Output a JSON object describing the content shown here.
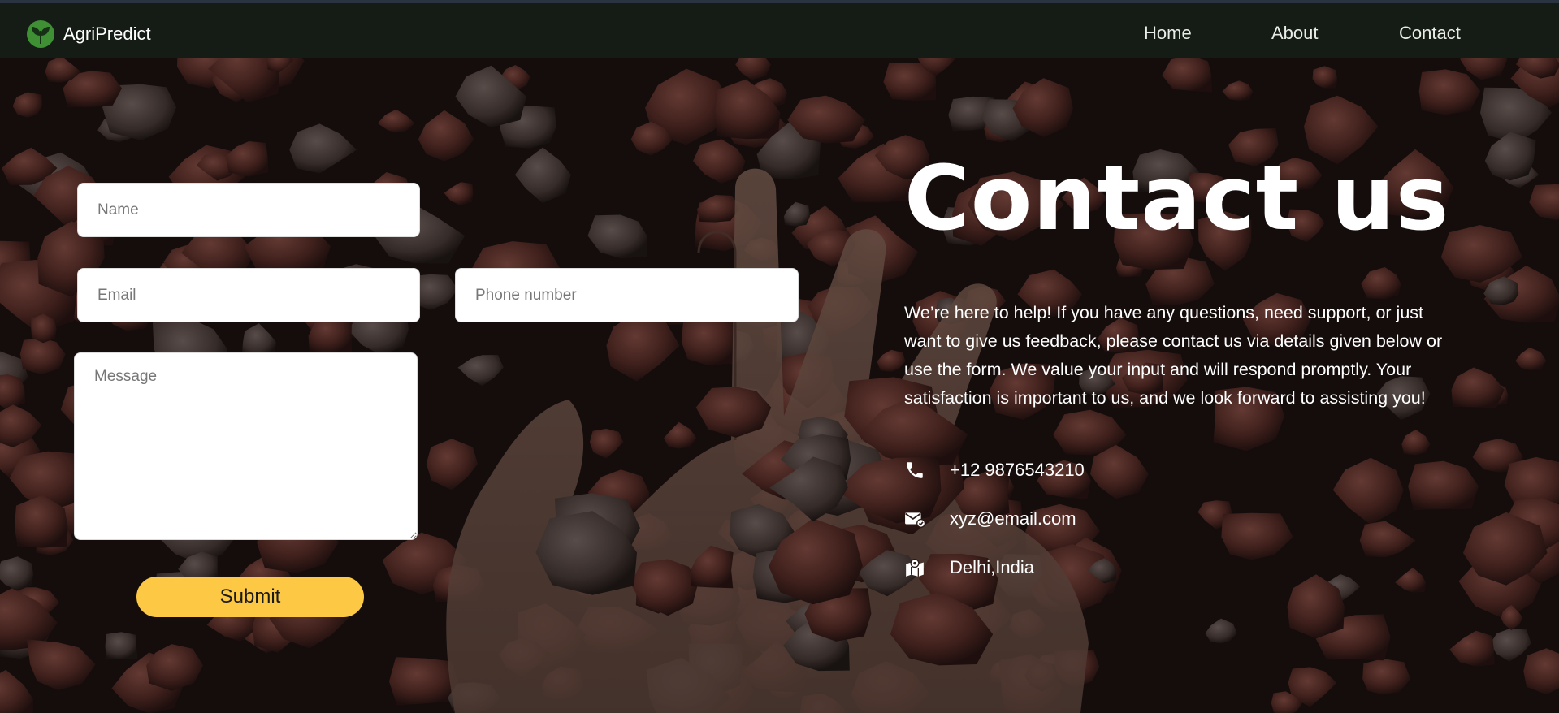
{
  "brand": {
    "name": "AgriPredict",
    "logo_icon": "leaf-logo-icon"
  },
  "nav": {
    "items": [
      {
        "label": "Home"
      },
      {
        "label": "About"
      },
      {
        "label": "Contact"
      }
    ]
  },
  "form": {
    "name_placeholder": "Name",
    "email_placeholder": "Email",
    "phone_placeholder": "Phone number",
    "message_placeholder": "Message",
    "submit_label": "Submit"
  },
  "contact": {
    "heading": "Contact us",
    "description": "We’re here to help! If you have any questions, need support, or just want to give us feedback, please contact us via details given below or use the form. We value your input and will respond promptly. Your satisfaction is important to us, and we look forward to assisting you!",
    "phone": "+12 9876543210",
    "email": "xyz@email.com",
    "location": "Delhi,India"
  },
  "colors": {
    "navbar_bg": "#141c15",
    "accent_submit": "#fdc844",
    "logo_green": "#4a9a3a"
  }
}
